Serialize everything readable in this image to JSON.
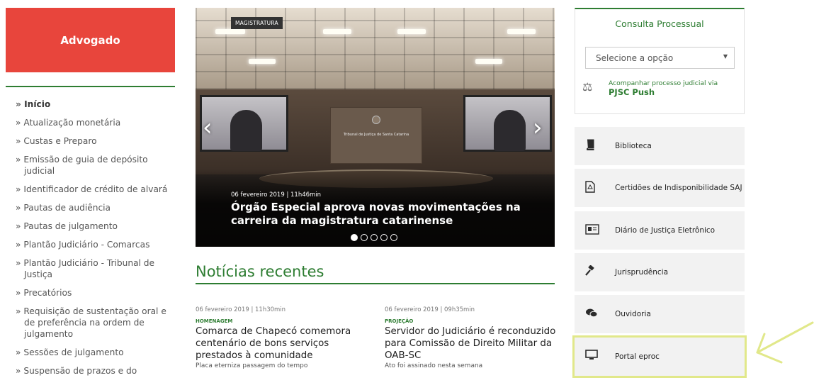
{
  "left": {
    "button_label": "Advogado",
    "menu": [
      "Início",
      "Atualização monetária",
      "Custas e Preparo",
      "Emissão de guia de depósito judicial",
      "Identificador de crédito de alvará",
      "Pautas de audiência",
      "Pautas de julgamento",
      "Plantão Judiciário - Comarcas",
      "Plantão Judiciário - Tribunal de Justiça",
      "Precatórios",
      "Requisição de sustentação oral e de preferência na ordem de julgamento",
      "Sessões de julgamento",
      "Suspensão de prazos e do"
    ]
  },
  "carousel": {
    "tag": "MAGISTRATURA",
    "court_name": "Tribunal de Justiça de Santa Catarina",
    "date": "06 fevereiro 2019 | 11h46min",
    "title": "Órgão Especial aprova novas movimentações na carreira da magistratura catarinense",
    "prev_arrow": "‹",
    "next_arrow": "›",
    "slide_count": 5,
    "active_slide": 1
  },
  "news": {
    "heading": "Notícias recentes",
    "items": [
      {
        "date": "06 fevereiro 2019 | 11h30min",
        "category": "HOMENAGEM",
        "title": "Comarca de Chapecó comemora centenário de bons serviços prestados à comunidade",
        "subtitle": "Placa eterniza passagem do tempo"
      },
      {
        "date": "06 fevereiro 2019 | 09h35min",
        "category": "PROJEÇÃO",
        "title": "Servidor do Judiciário é reconduzido para Comissão de Direito Militar da OAB-SC",
        "subtitle": "Ato foi assinado nesta semana"
      }
    ]
  },
  "consulta": {
    "title": "Consulta Processual",
    "select_value": "Selecione a opção",
    "push_line": "Acompanhar processo judicial via",
    "push_bold": "PJSC Push"
  },
  "services": [
    {
      "label": "Biblioteca",
      "icon": "book-icon"
    },
    {
      "label": "Certidões de Indisponibilidade SAJ",
      "icon": "document-icon"
    },
    {
      "label": "Diário de Justiça Eletrônico",
      "icon": "newspaper-icon"
    },
    {
      "label": "Jurisprudência",
      "icon": "gavel-icon"
    },
    {
      "label": "Ouvidoria",
      "icon": "chat-icon"
    },
    {
      "label": "Portal eproc",
      "icon": "monitor-icon"
    }
  ],
  "colors": {
    "accent_red": "#e8453c",
    "brand_green": "#2e7d32",
    "highlight_yellow": "#e1e88a"
  }
}
